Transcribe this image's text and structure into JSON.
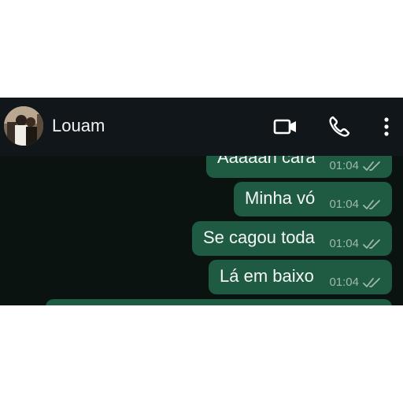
{
  "header": {
    "contact_name": "Louam",
    "icons": [
      "contact-avatar",
      "video-call-icon",
      "voice-call-icon",
      "more-options-icon"
    ]
  },
  "messages": [
    {
      "text": "Aaaaah cara",
      "time": "01:04",
      "status": "read"
    },
    {
      "text": "Minha vó",
      "time": "01:04",
      "status": "read"
    },
    {
      "text": "Se cagou toda",
      "time": "01:04",
      "status": "read"
    },
    {
      "text": "Lá em baixo",
      "time": "01:04",
      "status": "read"
    }
  ],
  "colors": {
    "header_bg": "#10161a",
    "chat_bg": "#0a130f",
    "outgoing_bubble": "#1f5a43",
    "text": "#f1f3f4",
    "meta_text": "#9eb9ad"
  }
}
